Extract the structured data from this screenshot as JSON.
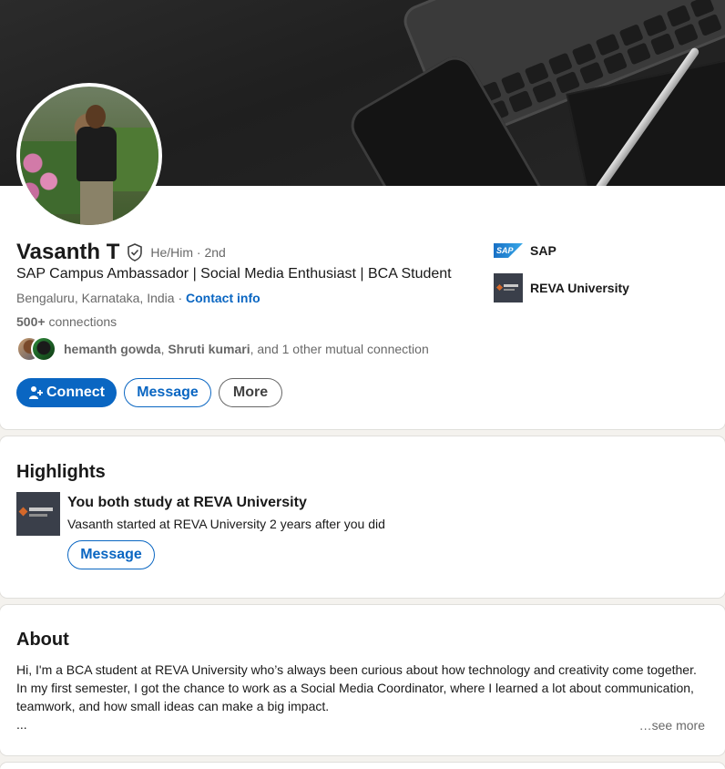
{
  "profile": {
    "name": "Vasanth T",
    "pronouns": "He/Him · 2nd",
    "headline": "SAP Campus Ambassador | Social Media Enthusiast | BCA Student",
    "location": "Bengaluru, Karnataka, India ·",
    "contact_info": "Contact info",
    "connections_count": "500+",
    "connections_label": "connections",
    "mutual": {
      "name1": "hemanth gowda",
      "sep": ",",
      "name2": "Shruti kumari",
      "rest": ", and 1 other mutual connection"
    },
    "actions": {
      "connect": "Connect",
      "message": "Message",
      "more": "More"
    },
    "orgs": [
      {
        "name": "SAP",
        "logo_text": "SAP"
      },
      {
        "name": "REVA University"
      }
    ]
  },
  "highlights": {
    "title": "Highlights",
    "item_title": "You both study at REVA University",
    "item_subtitle": "Vasanth started at REVA University 2 years after you did",
    "message": "Message"
  },
  "about": {
    "title": "About",
    "line1": "Hi, I'm a BCA student at REVA University who’s always been curious about how technology and creativity come together.",
    "line2": "In my first semester, I got the chance to work as a Social Media Coordinator, where I learned a lot about communication,",
    "line3": "teamwork, and how small ideas can make a big impact.",
    "line4": "...",
    "see_more": "…see more"
  },
  "colors": {
    "accent": "#0a66c2",
    "page_bg": "#f4f2ee"
  }
}
